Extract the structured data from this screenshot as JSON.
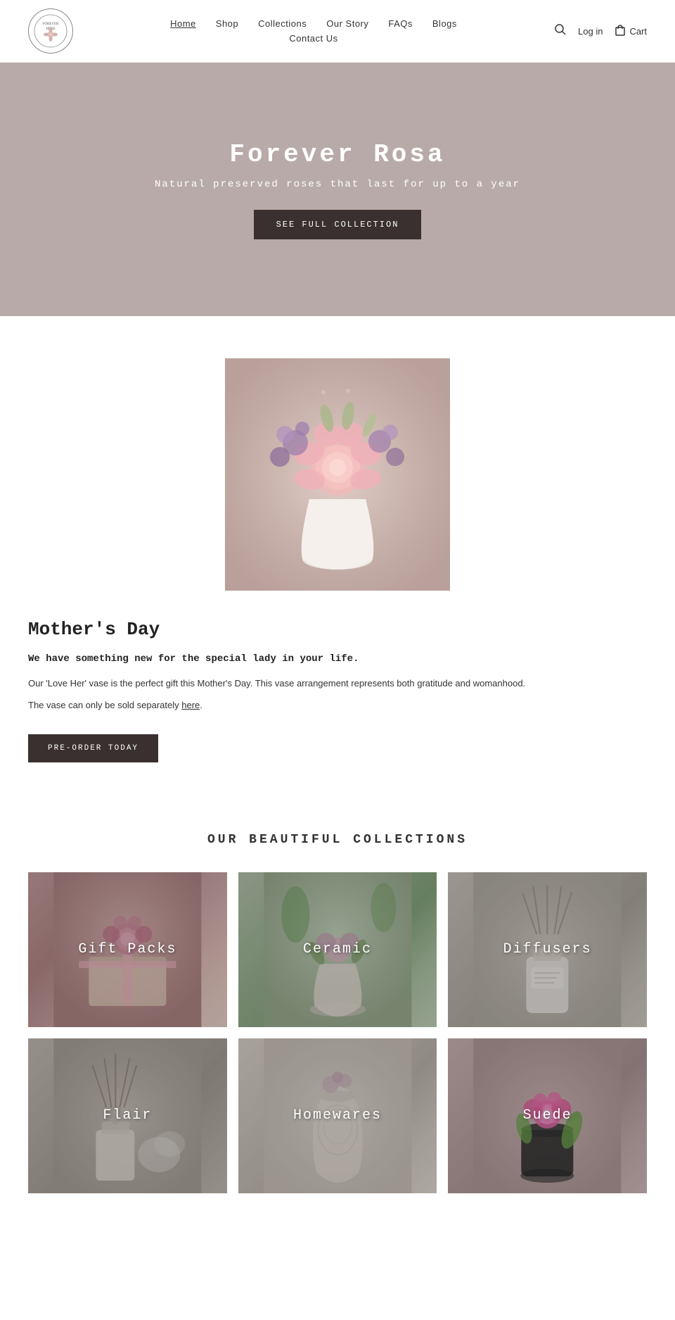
{
  "header": {
    "logo_text": "FOREVER ROSA",
    "logo_subtext": "FOREVER HERE",
    "nav_links": [
      {
        "label": "Home",
        "active": true
      },
      {
        "label": "Shop",
        "active": false
      },
      {
        "label": "Collections",
        "active": false
      },
      {
        "label": "Our Story",
        "active": false
      },
      {
        "label": "FAQs",
        "active": false
      },
      {
        "label": "Blogs",
        "active": false
      },
      {
        "label": "Contact Us",
        "active": false
      }
    ],
    "search_icon": "🔍",
    "login_label": "Log in",
    "cart_label": "Cart"
  },
  "hero": {
    "title": "Forever Rosa",
    "subtitle": "Natural preserved roses that last for up to a year",
    "cta_label": "SEE FULL COLLECTION",
    "bg_color": "#b8aaa8"
  },
  "featured": {
    "heading": "Mother's Day",
    "bold_line": "We have something new for the special lady in your life.",
    "body1": "Our 'Love Her' vase is the perfect gift this Mother's Day. This vase arrangement represents both gratitude and womanhood.",
    "body2": "The vase can only be sold separately",
    "link_text": "here",
    "cta_label": "PRE-ORDER TODAY"
  },
  "collections": {
    "section_title": "OUR BEAUTIFUL COLLECTIONS",
    "items": [
      {
        "label": "Gift Packs",
        "bg_class": "bg-gift-packs"
      },
      {
        "label": "Ceramic",
        "bg_class": "bg-ceramic"
      },
      {
        "label": "Diffusers",
        "bg_class": "bg-diffusers"
      },
      {
        "label": "Flair",
        "bg_class": "bg-flair"
      },
      {
        "label": "Homewares",
        "bg_class": "bg-homewares"
      },
      {
        "label": "Suede",
        "bg_class": "bg-suede"
      }
    ]
  }
}
